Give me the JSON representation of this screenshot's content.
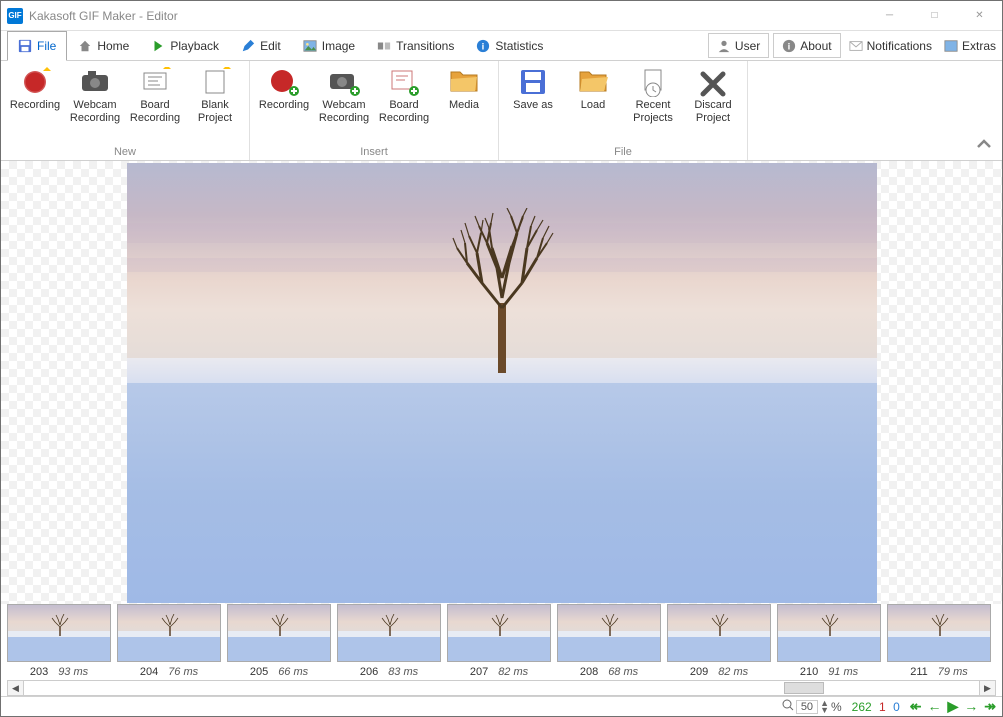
{
  "window": {
    "title": "Kakasoft GIF Maker - Editor",
    "app_icon_text": "GIF"
  },
  "menu": {
    "tabs": {
      "file": "File",
      "home": "Home",
      "playback": "Playback",
      "edit": "Edit",
      "image": "Image",
      "transitions": "Transitions",
      "statistics": "Statistics"
    },
    "right": {
      "user": "User",
      "about": "About",
      "notifications": "Notifications",
      "extras": "Extras"
    }
  },
  "ribbon": {
    "groups": {
      "new": "New",
      "insert": "Insert",
      "file": "File"
    },
    "new": {
      "recording": "Recording",
      "webcam": "Webcam Recording",
      "board": "Board Recording",
      "blank": "Blank Project"
    },
    "insert": {
      "recording": "Recording",
      "webcam": "Webcam Recording",
      "board": "Board Recording",
      "media": "Media"
    },
    "file": {
      "saveas": "Save as",
      "load": "Load",
      "recent": "Recent Projects",
      "discard": "Discard Project"
    }
  },
  "frames": [
    {
      "num": "203",
      "ms": "93 ms"
    },
    {
      "num": "204",
      "ms": "76 ms"
    },
    {
      "num": "205",
      "ms": "66 ms"
    },
    {
      "num": "206",
      "ms": "83 ms"
    },
    {
      "num": "207",
      "ms": "82 ms"
    },
    {
      "num": "208",
      "ms": "68 ms"
    },
    {
      "num": "209",
      "ms": "82 ms"
    },
    {
      "num": "210",
      "ms": "91 ms"
    },
    {
      "num": "211",
      "ms": "79 ms"
    }
  ],
  "status": {
    "zoom_value": "50",
    "zoom_pct": "%",
    "count_total": "262",
    "count_sel": "1",
    "count_other": "0"
  }
}
